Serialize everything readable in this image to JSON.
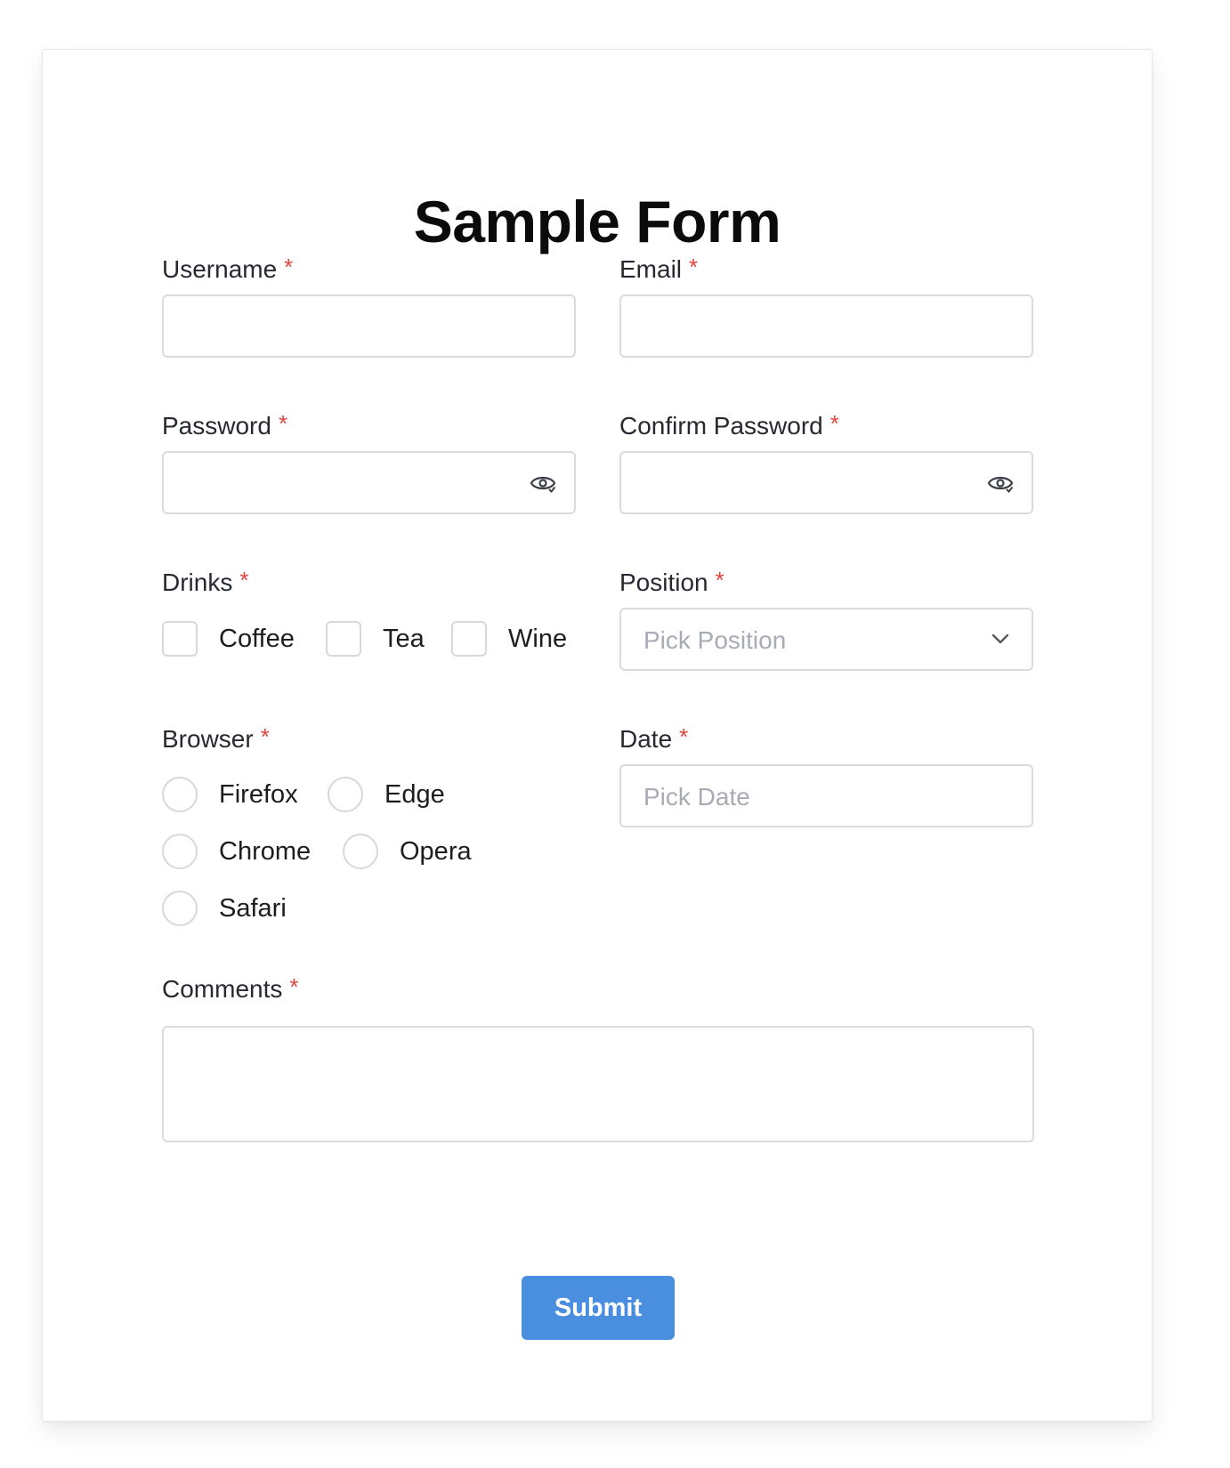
{
  "form": {
    "title": "Sample Form",
    "required_mark": "*",
    "username": {
      "label": "Username",
      "value": ""
    },
    "email": {
      "label": "Email",
      "value": ""
    },
    "password": {
      "label": "Password",
      "value": "",
      "icon": "eye-icon"
    },
    "confirm_password": {
      "label": "Confirm Password",
      "value": "",
      "icon": "eye-icon"
    },
    "drinks": {
      "label": "Drinks",
      "options": [
        {
          "label": "Coffee",
          "checked": false
        },
        {
          "label": "Tea",
          "checked": false
        },
        {
          "label": "Wine",
          "checked": false
        }
      ]
    },
    "position": {
      "label": "Position",
      "placeholder": "Pick Position",
      "icon": "chevron-down-icon"
    },
    "browser": {
      "label": "Browser",
      "options": [
        {
          "label": "Firefox",
          "selected": false
        },
        {
          "label": "Edge",
          "selected": false
        },
        {
          "label": "Chrome",
          "selected": false
        },
        {
          "label": "Opera",
          "selected": false
        },
        {
          "label": "Safari",
          "selected": false
        }
      ]
    },
    "date": {
      "label": "Date",
      "placeholder": "Pick Date"
    },
    "comments": {
      "label": "Comments",
      "value": ""
    },
    "submit_label": "Submit"
  },
  "colors": {
    "accent": "#4a8ee0",
    "required": "#e0453d",
    "border": "#d9dbe0",
    "placeholder": "#a7acb4"
  }
}
